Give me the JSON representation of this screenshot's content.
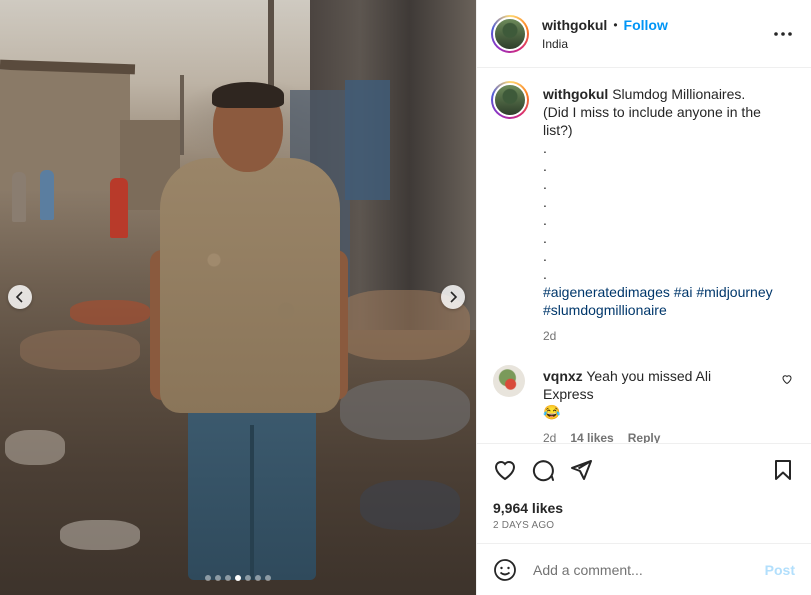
{
  "post": {
    "image_alt": "",
    "carousel": {
      "total": 7,
      "active_index": 3
    }
  },
  "header": {
    "username": "withgokul",
    "separator": "•",
    "follow_label": "Follow",
    "location": "India",
    "more_icon": "more-horizontal-icon"
  },
  "caption": {
    "username": "withgokul",
    "text_line1": "Slumdog Millionaires.",
    "text_line2": "(Did I miss to include anyone in the list?)",
    "dots": [
      ".",
      ".",
      ".",
      ".",
      ".",
      ".",
      ".",
      "."
    ],
    "hashtags": [
      "#aigeneratedimages",
      "#ai",
      "#midjourney",
      "#slumdogmillionaire"
    ],
    "time": "2d"
  },
  "comment": {
    "username": "vqnxz",
    "text": "Yeah you missed Ali Express",
    "emoji": "😂",
    "time": "2d",
    "likes": "14 likes",
    "reply_label": "Reply"
  },
  "actions": {
    "likes": "9,964 likes",
    "posted": "2 DAYS AGO"
  },
  "add_comment": {
    "placeholder": "Add a comment...",
    "post_label": "Post"
  },
  "colors": {
    "accent": "#0095f6",
    "hashtag": "#00376b",
    "post_disabled": "#b2dffc",
    "muted": "#737373"
  }
}
